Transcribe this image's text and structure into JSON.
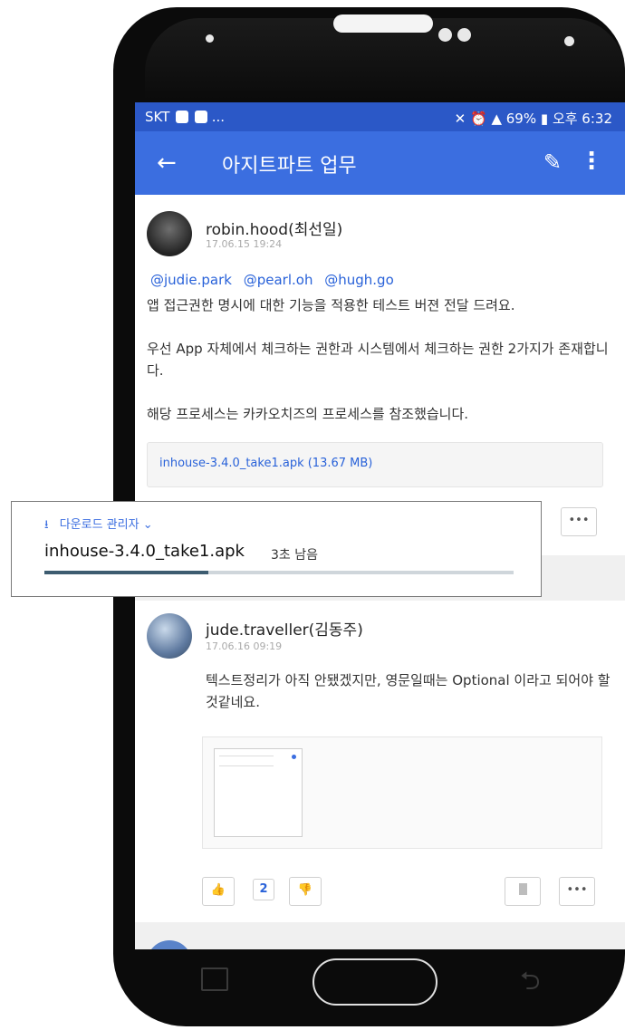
{
  "status_bar": {
    "carrier": "SKT",
    "left_extra": "...",
    "battery_pct": "69%",
    "time": "오후 6:32"
  },
  "app_bar": {
    "back_glyph": "←",
    "title": "아지트파트 업무",
    "compose_glyph": "✎",
    "more_glyph": "⋮"
  },
  "posts": [
    {
      "author": "robin.hood(최선일)",
      "date": "17.06.15 19:24",
      "mentions": [
        "@judie.park",
        "@pearl.oh",
        "@hugh.go"
      ],
      "paragraphs": [
        "앱 접근권한 명시에 대한 기능을 적용한 테스트 버젼 전달 드려요.",
        "우선 App 자체에서 체크하는 권한과 시스템에서 체크하는 권한 2가지가 존재합니다.",
        "해당 프로세스는 카카오치즈의 프로세스를 참조했습니다."
      ],
      "attachment": "inhouse-3.4.0_take1.apk (13.67 MB)",
      "more_label": "•••"
    },
    {
      "author": "jude.traveller(김동주)",
      "date": "17.06.16 09:19",
      "text": "텍스트정리가 아직 안됐겠지만, 영문일때는 Optional 이라고 되어야 할 것같네요.",
      "like_glyph": "👍",
      "like_count": "2",
      "dislike_glyph": "👎",
      "more_label": "•••"
    }
  ],
  "download": {
    "icon_glyph": "⭳",
    "header": "다운로드 관리자",
    "chevron": "⌄",
    "filename": "inhouse-3.4.0_take1.apk",
    "remaining": "3초 남음",
    "progress": 0.35
  },
  "nav": {
    "back_glyph": "⮌"
  },
  "colors": {
    "accent": "#3b6ee0",
    "status": "#2b58c7",
    "progress": "#3d5c70"
  }
}
